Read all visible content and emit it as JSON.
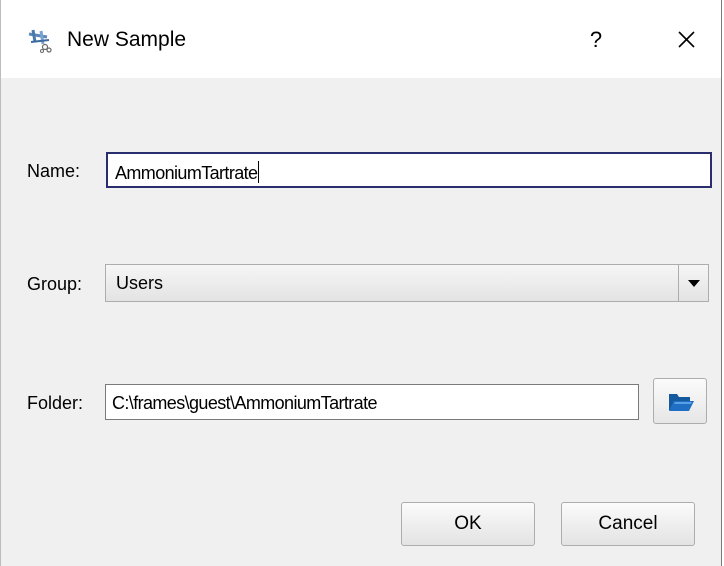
{
  "window": {
    "title": "New Sample",
    "help_label": "?",
    "app_icon": "molecule-icon",
    "close_icon": "close-icon"
  },
  "form": {
    "name": {
      "label": "Name:",
      "value": "AmmoniumTartrate"
    },
    "group": {
      "label": "Group:",
      "value": "Users"
    },
    "folder": {
      "label": "Folder:",
      "value": "C:\\frames\\guest\\AmmoniumTartrate",
      "browse_icon": "folder-open-icon"
    }
  },
  "buttons": {
    "ok_label": "OK",
    "cancel_label": "Cancel"
  },
  "colors": {
    "focus_border": "#2b2e6e",
    "dialog_background": "#f0f0f0",
    "browse_icon_blue": "#1e6fc4"
  }
}
